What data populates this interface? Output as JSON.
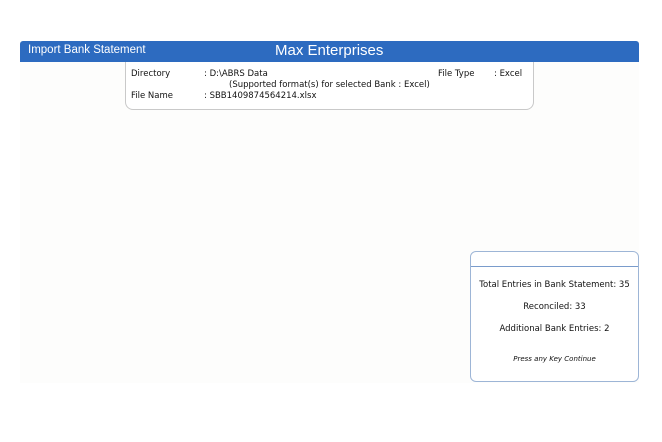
{
  "window": {
    "title": "Import Bank Statement",
    "company": "Max Enterprises"
  },
  "info": {
    "directory_label": "Directory",
    "directory_value": ": D:\\ABRS Data",
    "supported_note": "(Supported format(s) for selected Bank : Excel)",
    "file_name_label": "File Name",
    "file_name_value": ": SBB1409874564214.xlsx",
    "file_type_label": "File Type",
    "file_type_value": ": Excel"
  },
  "summary": {
    "total_entries": "Total Entries in Bank Statement: 35",
    "reconciled": "Reconciled: 33",
    "additional_entries": "Additional Bank Entries: 2",
    "prompt": "Press any Key Continue"
  },
  "colors": {
    "titlebar": "#2d6bc0",
    "summary_border": "#9db5d6"
  }
}
